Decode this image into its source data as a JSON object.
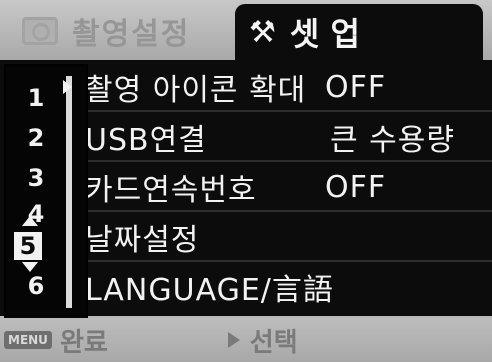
{
  "tabs": {
    "shooting_label": "촬영설정",
    "setup_label": "셋 업",
    "setup_tools_glyph": "⚒"
  },
  "menu_rows": [
    {
      "label": "촬영 아이콘 확대",
      "value": "OFF"
    },
    {
      "label": "USB연결",
      "value": "큰 수용량"
    },
    {
      "label": "카드연속번호",
      "value": "OFF"
    },
    {
      "label": "날짜설정",
      "value": ""
    },
    {
      "label": "LANGUAGE/言語",
      "value": ""
    }
  ],
  "page_numbers": [
    "1",
    "2",
    "3",
    "4",
    "5",
    "6"
  ],
  "active_page": "5",
  "footer": {
    "menu_badge": "MENU",
    "end_label": "완료",
    "select_label": "선택"
  },
  "colors": {
    "background": "#b8b8b8",
    "menu_bg": "#0c0c0c",
    "text": "#f2f2f2",
    "footer_text": "#7a7a7a"
  },
  "icons": [
    "camera-icon",
    "tools-icon",
    "right-arrow-icon",
    "scroll-up-icon",
    "scroll-down-icon",
    "play-icon"
  ]
}
